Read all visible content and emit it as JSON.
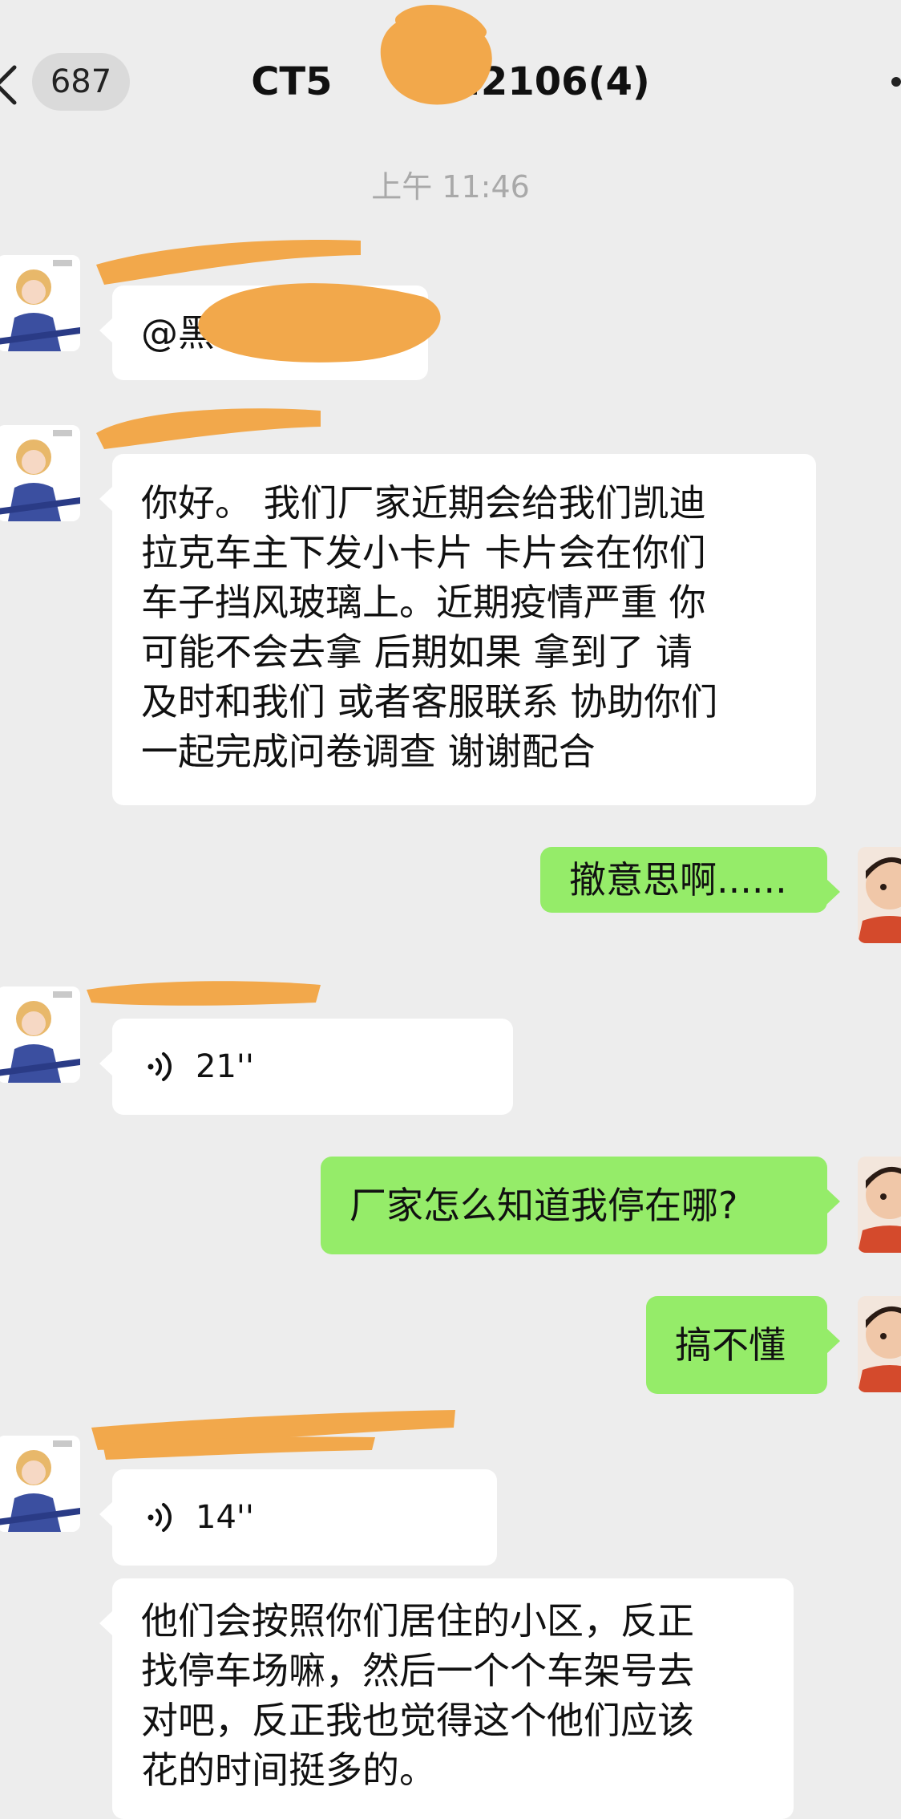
{
  "header": {
    "unread_count": "687",
    "title": "CT5          .2106(4)"
  },
  "timestamp": "上午 11:46",
  "messages": [
    {
      "sender": "agent",
      "type": "text",
      "lines": [
        "@黑"
      ]
    },
    {
      "sender": "agent",
      "type": "text",
      "lines": [
        "你好。 我们厂家近期会给我们凯迪",
        "拉克车主下发小卡片 卡片会在你们",
        "车子挡风玻璃上。近期疫情严重 你",
        "可能不会去拿 后期如果 拿到了 请",
        "及时和我们 或者客服联系 协助你们",
        "一起完成问卷调查 谢谢配合"
      ]
    },
    {
      "sender": "me",
      "type": "text",
      "lines": [
        "撤意思啊......"
      ]
    },
    {
      "sender": "agent",
      "type": "voice",
      "duration": "21''"
    },
    {
      "sender": "me",
      "type": "text",
      "lines": [
        "厂家怎么知道我停在哪?"
      ]
    },
    {
      "sender": "me",
      "type": "text",
      "lines": [
        "搞不懂"
      ]
    },
    {
      "sender": "agent",
      "type": "voice",
      "duration": "14''"
    },
    {
      "sender": "agent",
      "type": "text",
      "lines": [
        "他们会按照你们居住的小区，反正",
        "找停车场嘛，然后一个个车架号去",
        "对吧，反正我也觉得这个他们应该",
        "花的时间挺多的。"
      ]
    }
  ],
  "colors": {
    "background": "#ededed",
    "my_bubble": "#95ec69",
    "their_bubble": "#ffffff",
    "redaction": "#f2a84b"
  },
  "icons": {
    "back": "chevron-left-icon",
    "voice": "voice-wave-icon",
    "more": "more-icon"
  }
}
